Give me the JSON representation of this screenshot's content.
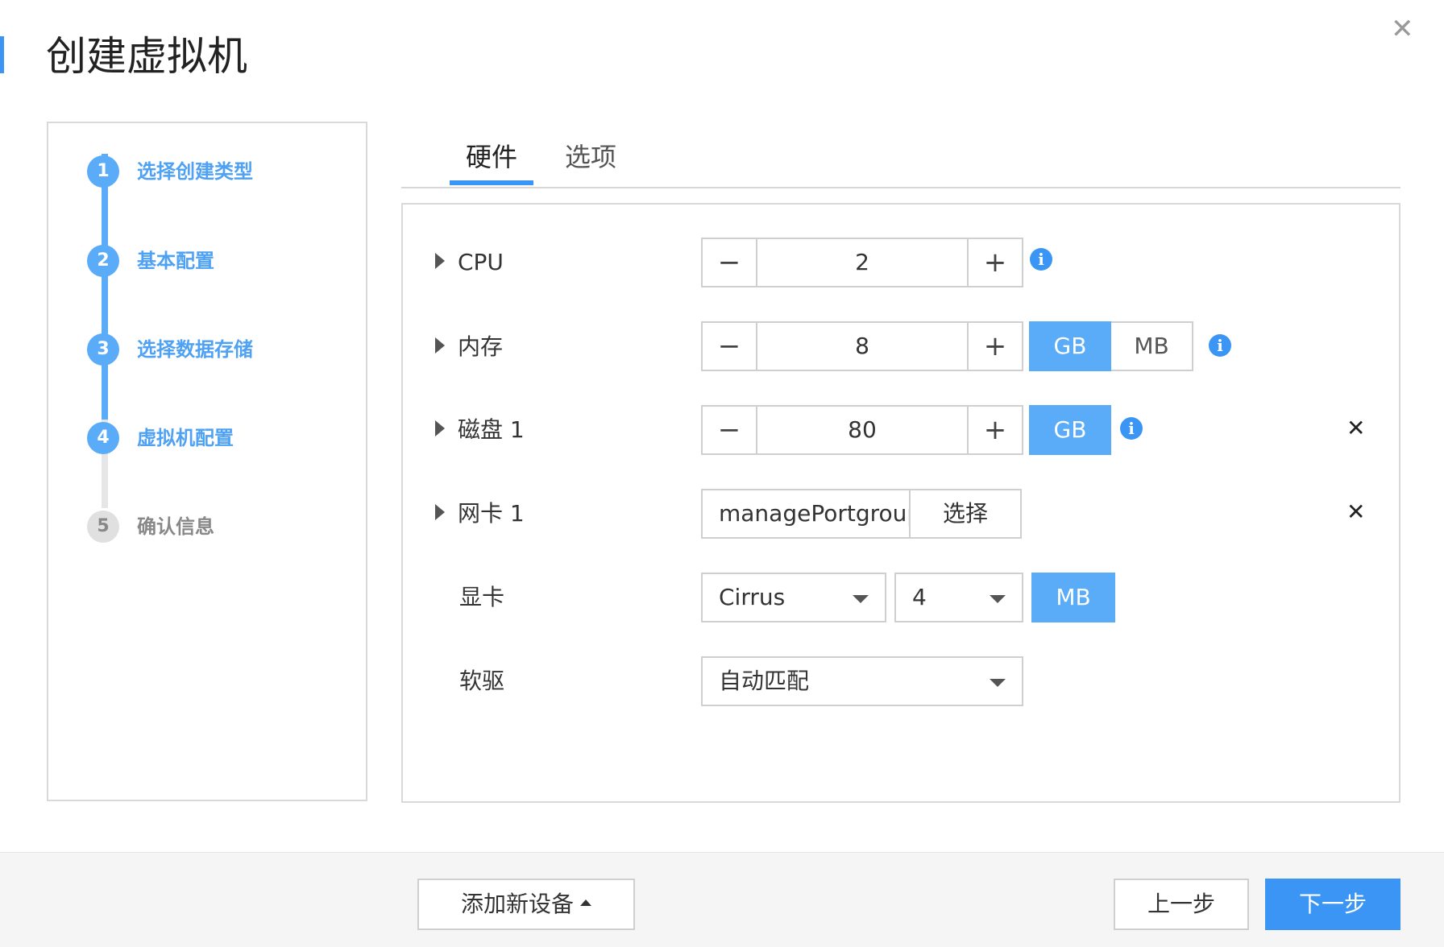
{
  "dialog": {
    "title": "创建虚拟机",
    "close_icon": "close-icon"
  },
  "steps": [
    {
      "num": "1",
      "label": "选择创建类型",
      "state": "active"
    },
    {
      "num": "2",
      "label": "基本配置",
      "state": "active"
    },
    {
      "num": "3",
      "label": "选择数据存储",
      "state": "active"
    },
    {
      "num": "4",
      "label": "虚拟机配置",
      "state": "active"
    },
    {
      "num": "5",
      "label": "确认信息",
      "state": "inactive"
    }
  ],
  "tabs": [
    {
      "label": "硬件",
      "active": true
    },
    {
      "label": "选项",
      "active": false
    }
  ],
  "hardware": {
    "cpu": {
      "label": "CPU",
      "value": "2",
      "minus": "−",
      "plus": "+"
    },
    "memory": {
      "label": "内存",
      "value": "8",
      "minus": "−",
      "plus": "+",
      "units": [
        "GB",
        "MB"
      ],
      "selected_unit": "GB"
    },
    "disk": {
      "label": "磁盘 1",
      "value": "80",
      "minus": "−",
      "plus": "+",
      "unit": "GB"
    },
    "nic": {
      "label": "网卡 1",
      "value": "managePortgroup",
      "select_label": "选择"
    },
    "gpu": {
      "label": "显卡",
      "model": "Cirrus",
      "size": "4",
      "unit": "MB"
    },
    "floppy": {
      "label": "软驱",
      "value": "自动匹配"
    }
  },
  "icons": {
    "info": "i",
    "remove": "✕"
  },
  "footer": {
    "add_device": "添加新设备",
    "prev": "上一步",
    "next": "下一步"
  },
  "colors": {
    "accent": "#3b95f5",
    "accent_light": "#5aabf8",
    "inactive": "#e0e0e0"
  }
}
